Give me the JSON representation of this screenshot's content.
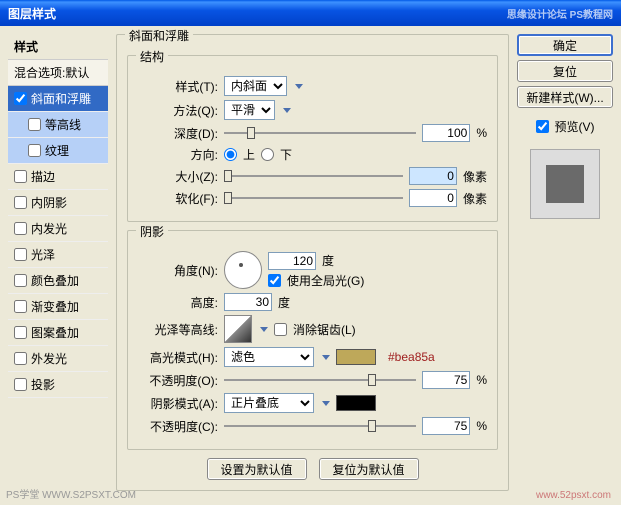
{
  "window": {
    "title": "图层样式",
    "watermark_tr": "思缘设计论坛  PS教程网"
  },
  "left": {
    "header": "样式",
    "blend_opts": "混合选项:默认",
    "items": [
      {
        "label": "斜面和浮雕",
        "checked": true,
        "selected": true,
        "indent": false
      },
      {
        "label": "等高线",
        "checked": false,
        "selected": false,
        "indent": true,
        "sub": true
      },
      {
        "label": "纹理",
        "checked": false,
        "selected": false,
        "indent": true,
        "sub": true
      },
      {
        "label": "描边",
        "checked": false,
        "selected": false,
        "indent": false
      },
      {
        "label": "内阴影",
        "checked": false,
        "selected": false,
        "indent": false
      },
      {
        "label": "内发光",
        "checked": false,
        "selected": false,
        "indent": false
      },
      {
        "label": "光泽",
        "checked": false,
        "selected": false,
        "indent": false
      },
      {
        "label": "颜色叠加",
        "checked": false,
        "selected": false,
        "indent": false
      },
      {
        "label": "渐变叠加",
        "checked": false,
        "selected": false,
        "indent": false
      },
      {
        "label": "图案叠加",
        "checked": false,
        "selected": false,
        "indent": false
      },
      {
        "label": "外发光",
        "checked": false,
        "selected": false,
        "indent": false
      },
      {
        "label": "投影",
        "checked": false,
        "selected": false,
        "indent": false
      }
    ]
  },
  "bevel": {
    "group_title": "斜面和浮雕",
    "structure": {
      "legend": "结构",
      "style_lbl": "样式(T):",
      "style_val": "内斜面",
      "tech_lbl": "方法(Q):",
      "tech_val": "平滑",
      "depth_lbl": "深度(D):",
      "depth_val": "100",
      "pct": "%",
      "dir_lbl": "方向:",
      "dir_up": "上",
      "dir_down": "下",
      "size_lbl": "大小(Z):",
      "size_val": "0",
      "px": "像素",
      "soften_lbl": "软化(F):",
      "soften_val": "0"
    },
    "shading": {
      "legend": "阴影",
      "angle_lbl": "角度(N):",
      "angle_val": "120",
      "deg": "度",
      "global_lbl": "使用全局光(G)",
      "alt_lbl": "高度:",
      "alt_val": "30",
      "contour_lbl": "光泽等高线:",
      "anti_lbl": "消除锯齿(L)",
      "hi_mode_lbl": "高光模式(H):",
      "hi_mode_val": "滤色",
      "hi_opac_lbl": "不透明度(O):",
      "hi_opac_val": "75",
      "sh_mode_lbl": "阴影模式(A):",
      "sh_mode_val": "正片叠底",
      "sh_opac_lbl": "不透明度(C):",
      "sh_opac_val": "75",
      "hex_note": "#bea85a",
      "hi_color": "#bea85a",
      "sh_color": "#000000"
    },
    "buttons": {
      "make_default": "设置为默认值",
      "reset_default": "复位为默认值"
    }
  },
  "right": {
    "ok": "确定",
    "cancel": "复位",
    "new_style": "新建样式(W)...",
    "preview_lbl": "预览(V)"
  },
  "footer": {
    "wm1": "PS学堂  WWW.S2PSXT.COM",
    "wm2": "www.52psxt.com"
  }
}
